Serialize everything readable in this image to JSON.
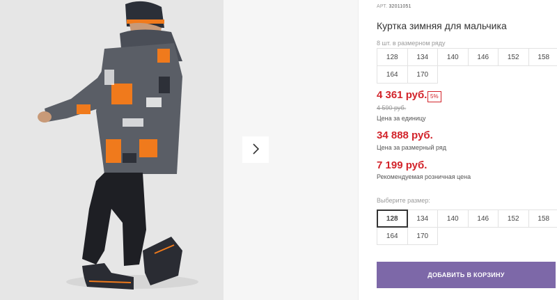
{
  "product": {
    "sku_label": "АРТ.",
    "sku_value": "32011051",
    "title": "Куртка зимняя для мальчика",
    "pack_note": "8 шт. в размерном ряду",
    "pack_sizes": [
      "128",
      "134",
      "140",
      "146",
      "152",
      "158",
      "164",
      "170"
    ],
    "price": "4 361 руб.",
    "discount": "5%",
    "old_price": "4 590 руб.",
    "unit_label": "Цена за единицу",
    "set_price": "34 888 руб.",
    "set_label": "Цена за размерный ряд",
    "retail_price": "7 199 руб.",
    "retail_label": "Рекомендуемая розничная цена"
  },
  "size_selector": {
    "label": "Выберите размер:",
    "sizes": [
      "128",
      "134",
      "140",
      "146",
      "152",
      "158",
      "164",
      "170"
    ],
    "selected": "128"
  },
  "actions": {
    "add_to_cart": "ДОБАВИТЬ В КОРЗИНУ"
  },
  "colors": {
    "price_red": "#d2232a",
    "button_purple": "#7d68a8",
    "jacket_orange": "#f07a1c"
  },
  "icons": {
    "next": "chevron-right-icon"
  }
}
